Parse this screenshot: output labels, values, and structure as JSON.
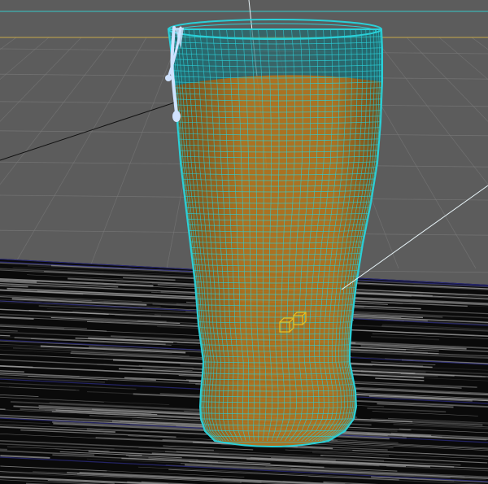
{
  "viewport": {
    "background_color": "#5c5c5c",
    "grid_color": "#7a7a7a",
    "horizon_line_color": "#c8a84a",
    "top_line_color": "#36c8c8",
    "wireframe_color": "#2ad0d8",
    "liquid_color": "#b8741a",
    "liquid_dark_color": "#6e4410",
    "glass_tint_color": "#1e6a70",
    "light_line_color": "#e8f4f8",
    "drip_color": "#cfe2ff",
    "gizmo_color": "#e8c020",
    "floor_base_color": "#0a0a0a",
    "floor_streak_color": "#9a9a9a",
    "floor_edge_color": "#2a2a7a"
  },
  "objects": [
    {
      "name": "pint-glass",
      "icon": "wireframe-mesh-icon"
    },
    {
      "name": "beer-liquid",
      "icon": "mesh-icon"
    },
    {
      "name": "condensation-drip",
      "icon": "droplet-icon"
    },
    {
      "name": "pivot-gizmo",
      "icon": "cube-icon"
    },
    {
      "name": "floor-plane",
      "icon": "plane-icon"
    }
  ]
}
